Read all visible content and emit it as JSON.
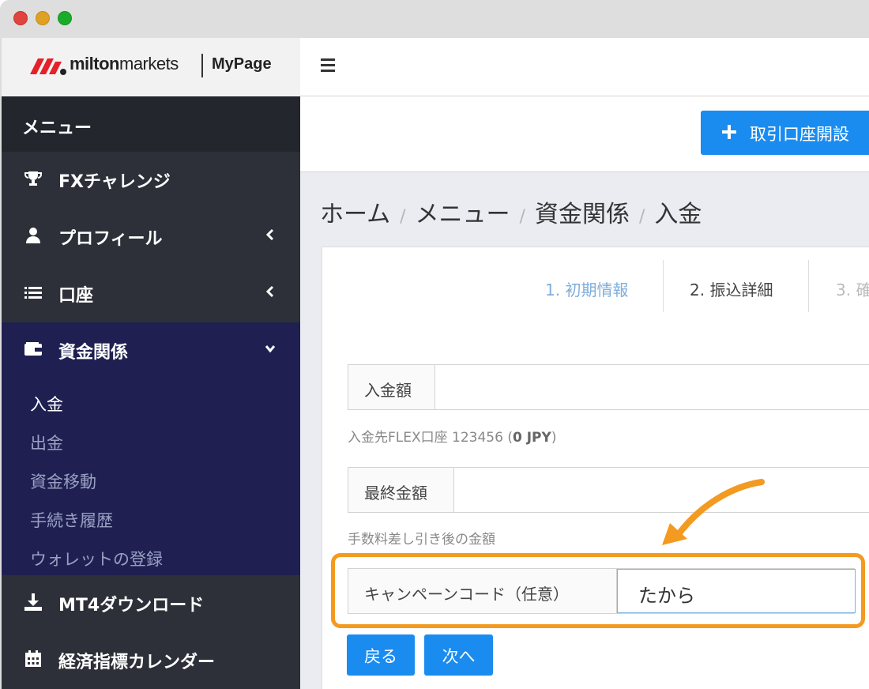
{
  "logo": {
    "brand_bold": "milton",
    "brand_rest": "markets",
    "mypage": "MyPage"
  },
  "sidebar": {
    "header": "メニュー",
    "items": [
      {
        "label": "FXチャレンジ",
        "icon": "trophy-icon"
      },
      {
        "label": "プロフィール",
        "icon": "user-icon"
      },
      {
        "label": "口座",
        "icon": "list-icon"
      },
      {
        "label": "資金関係",
        "icon": "wallet-icon"
      },
      {
        "label": "MT4ダウンロード",
        "icon": "download-icon"
      },
      {
        "label": "経済指標カレンダー",
        "icon": "calendar-icon"
      }
    ],
    "sub_items": [
      "入金",
      "出金",
      "資金移動",
      "手続き履歴",
      "ウォレットの登録"
    ]
  },
  "actions": {
    "open_account": "取引口座開設"
  },
  "breadcrumb": [
    "ホーム",
    "メニュー",
    "資金関係",
    "入金"
  ],
  "steps": [
    "1. 初期情報",
    "2. 振込詳細",
    "3. 確"
  ],
  "form": {
    "deposit_label": "入金額",
    "deposit_help_prefix": "入金先FLEX口座 123456 (",
    "deposit_help_value": "0 JPY",
    "deposit_help_suffix": ")",
    "final_label": "最終金額",
    "final_help": "手数料差し引き後の金額",
    "campaign_label": "キャンペーンコード（任意）",
    "campaign_value": "たから"
  },
  "buttons": {
    "back": "戻る",
    "next": "次へ"
  },
  "colors": {
    "accent": "#1a8cf0",
    "highlight": "#f39a21",
    "sidebar": "#2d3038",
    "sidebar_active": "#1f2051"
  }
}
